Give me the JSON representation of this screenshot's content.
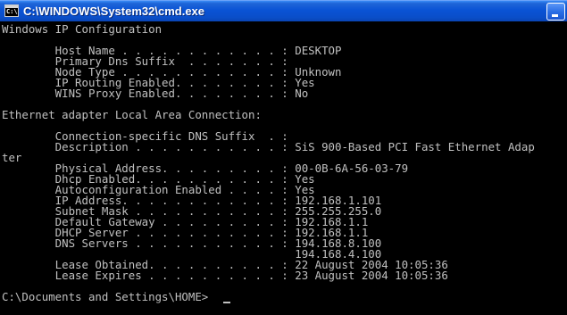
{
  "window": {
    "title": "C:\\WINDOWS\\System32\\cmd.exe",
    "icon": "console-icon",
    "icon_text": "C:\\"
  },
  "terminal": {
    "lines": [
      "Windows IP Configuration",
      "",
      "        Host Name . . . . . . . . . . . . : DESKTOP",
      "        Primary Dns Suffix  . . . . . . . :",
      "        Node Type . . . . . . . . . . . . : Unknown",
      "        IP Routing Enabled. . . . . . . . : Yes",
      "        WINS Proxy Enabled. . . . . . . . : No",
      "",
      "Ethernet adapter Local Area Connection:",
      "",
      "        Connection-specific DNS Suffix  . :",
      "        Description . . . . . . . . . . . : SiS 900-Based PCI Fast Ethernet Adap",
      "ter",
      "        Physical Address. . . . . . . . . : 00-0B-6A-56-03-79",
      "        Dhcp Enabled. . . . . . . . . . . : Yes",
      "        Autoconfiguration Enabled . . . . : Yes",
      "        IP Address. . . . . . . . . . . . : 192.168.1.101",
      "        Subnet Mask . . . . . . . . . . . : 255.255.255.0",
      "        Default Gateway . . . . . . . . . : 192.168.1.1",
      "        DHCP Server . . . . . . . . . . . : 192.168.1.1",
      "        DNS Servers . . . . . . . . . . . : 194.168.8.100",
      "                                            194.168.4.100",
      "        Lease Obtained. . . . . . . . . . : 22 August 2004 10:05:36",
      "        Lease Expires . . . . . . . . . . : 23 August 2004 10:05:36",
      "",
      "C:\\Documents and Settings\\HOME>"
    ]
  },
  "colors": {
    "background": "#000000",
    "text": "#c0c0c0",
    "titlebar": "#0a53d5"
  }
}
